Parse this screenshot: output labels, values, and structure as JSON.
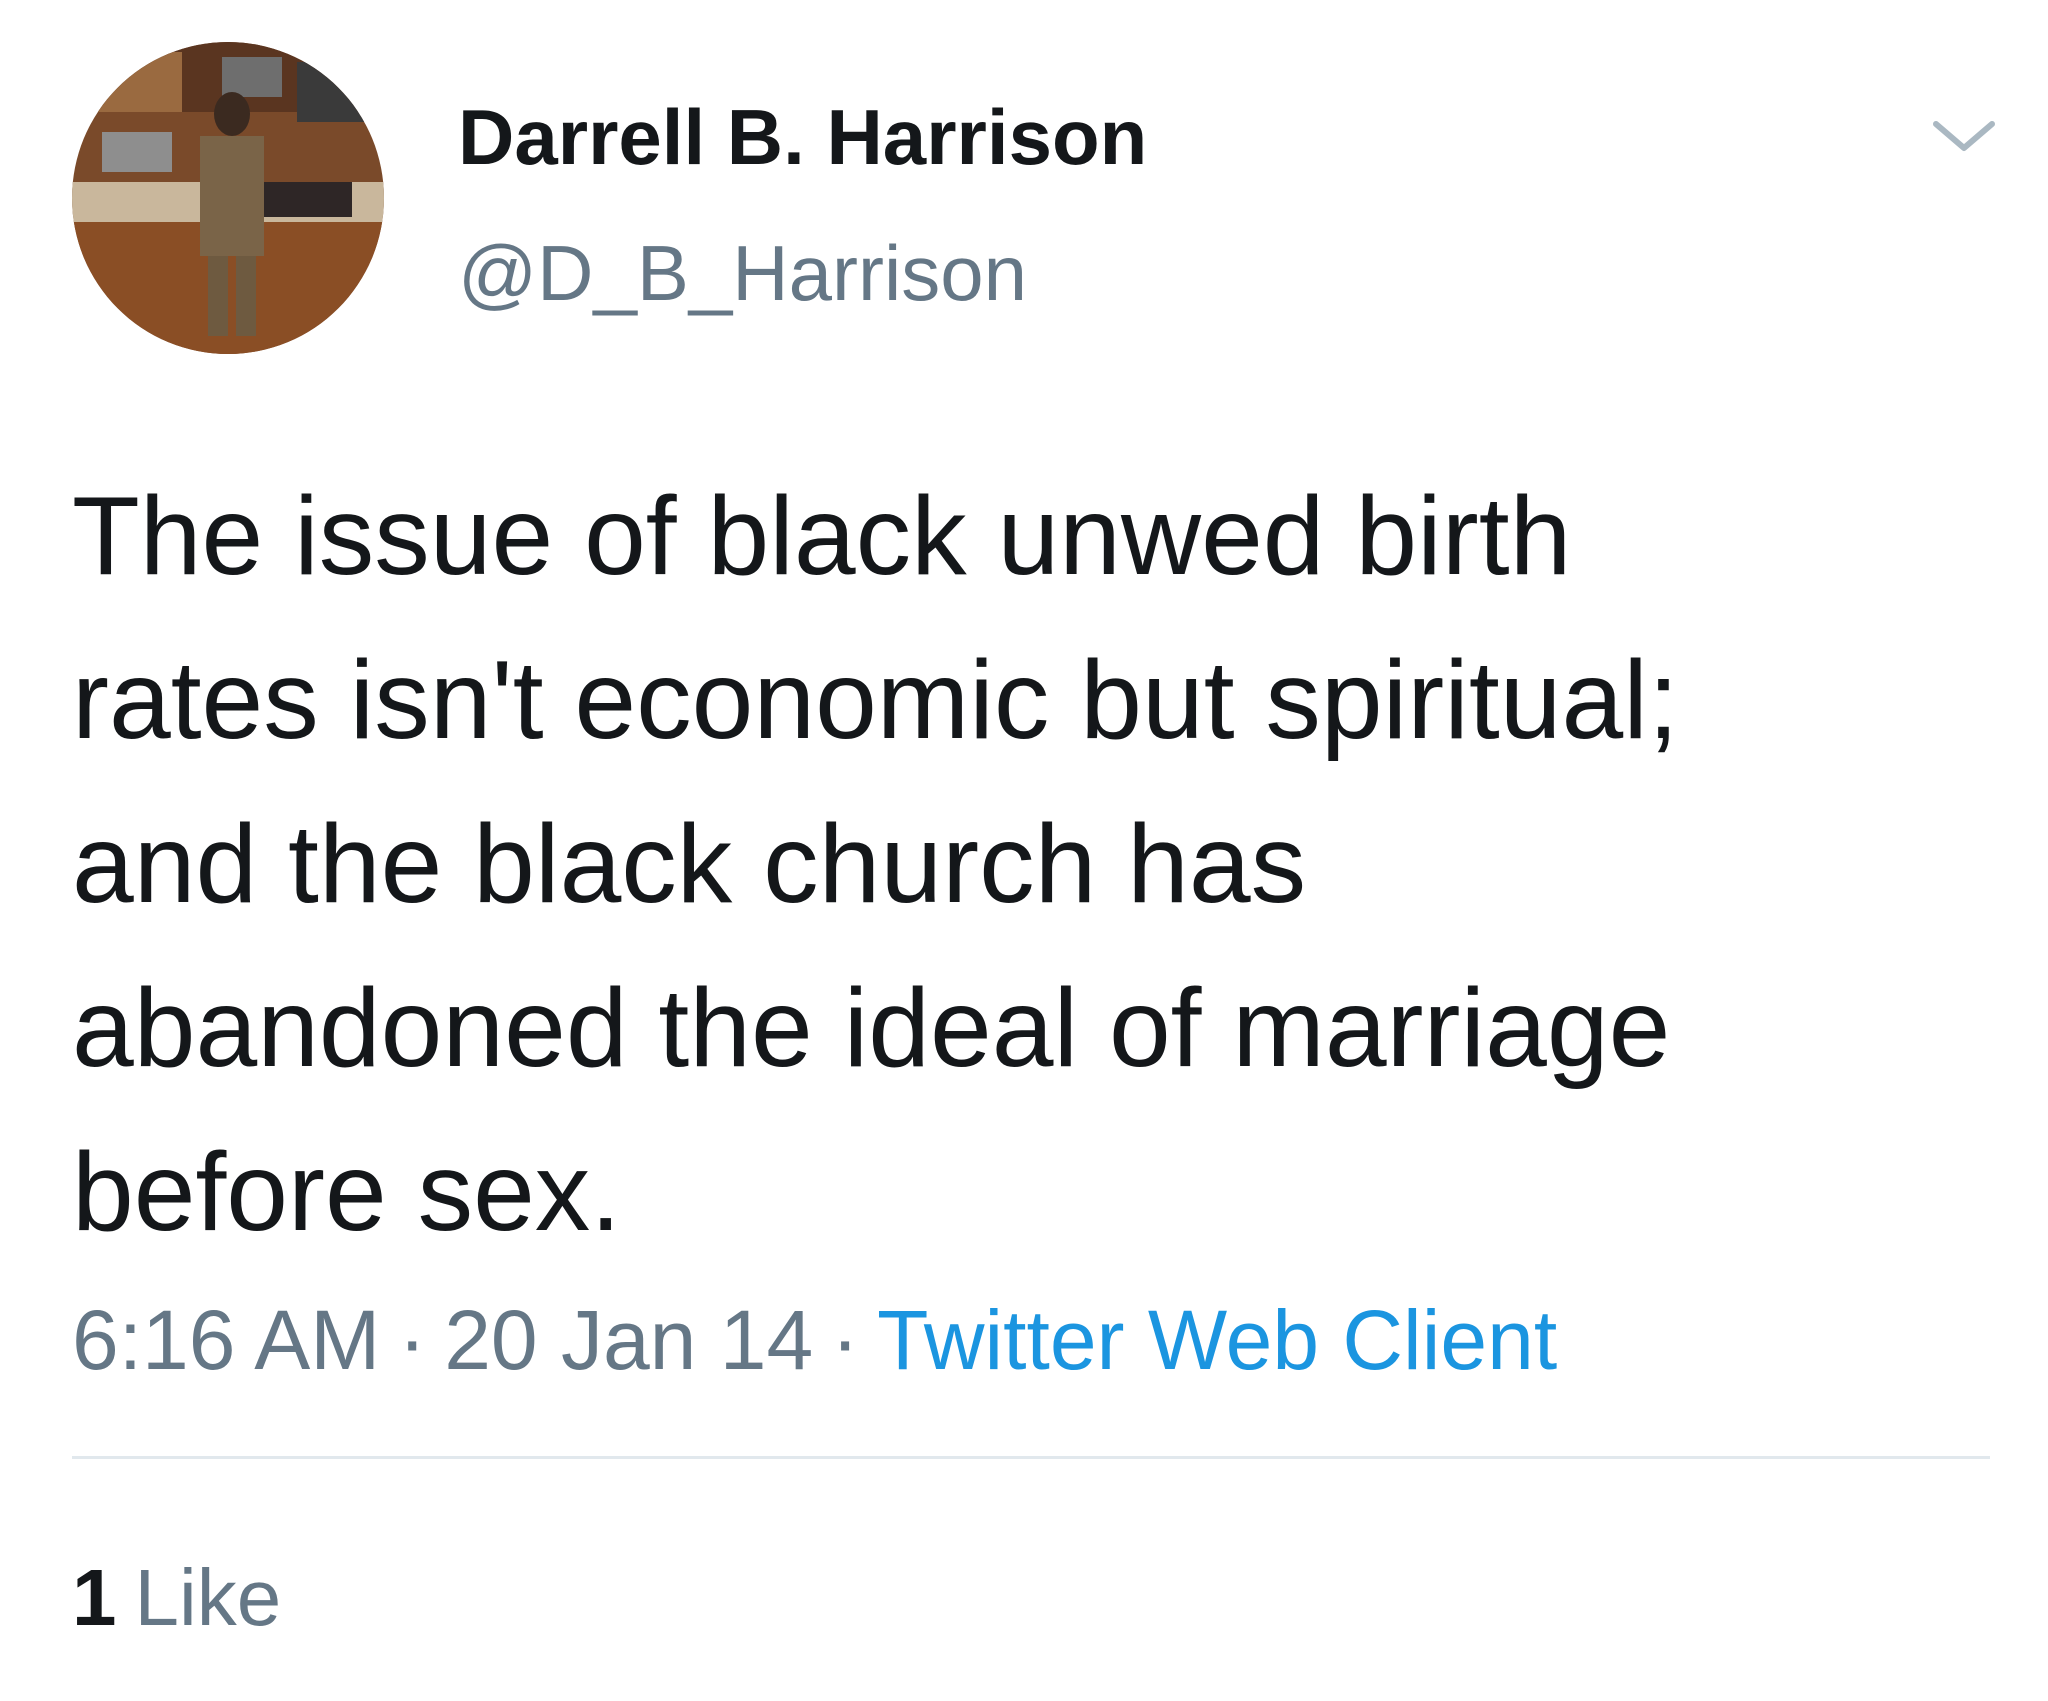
{
  "author": {
    "display_name": "Darrell B. Harrison",
    "handle": "@D_B_Harrison",
    "avatar_icon": "profile-photo"
  },
  "menu": {
    "icon": "chevron-down-icon"
  },
  "tweet": {
    "text": "The issue of black unwed birth\nrates isn't economic but spiritual;\nand the black church has\nabandoned the ideal of marriage\nbefore sex."
  },
  "meta": {
    "time": "6:16 AM",
    "separator": "·",
    "date": "20 Jan 14",
    "client": "Twitter Web Client"
  },
  "stats": {
    "likes_count": "1",
    "likes_label": "Like"
  },
  "colors": {
    "text": "#14171a",
    "secondary": "#657786",
    "link": "#1b95e0",
    "divider": "#e1e8ed"
  }
}
